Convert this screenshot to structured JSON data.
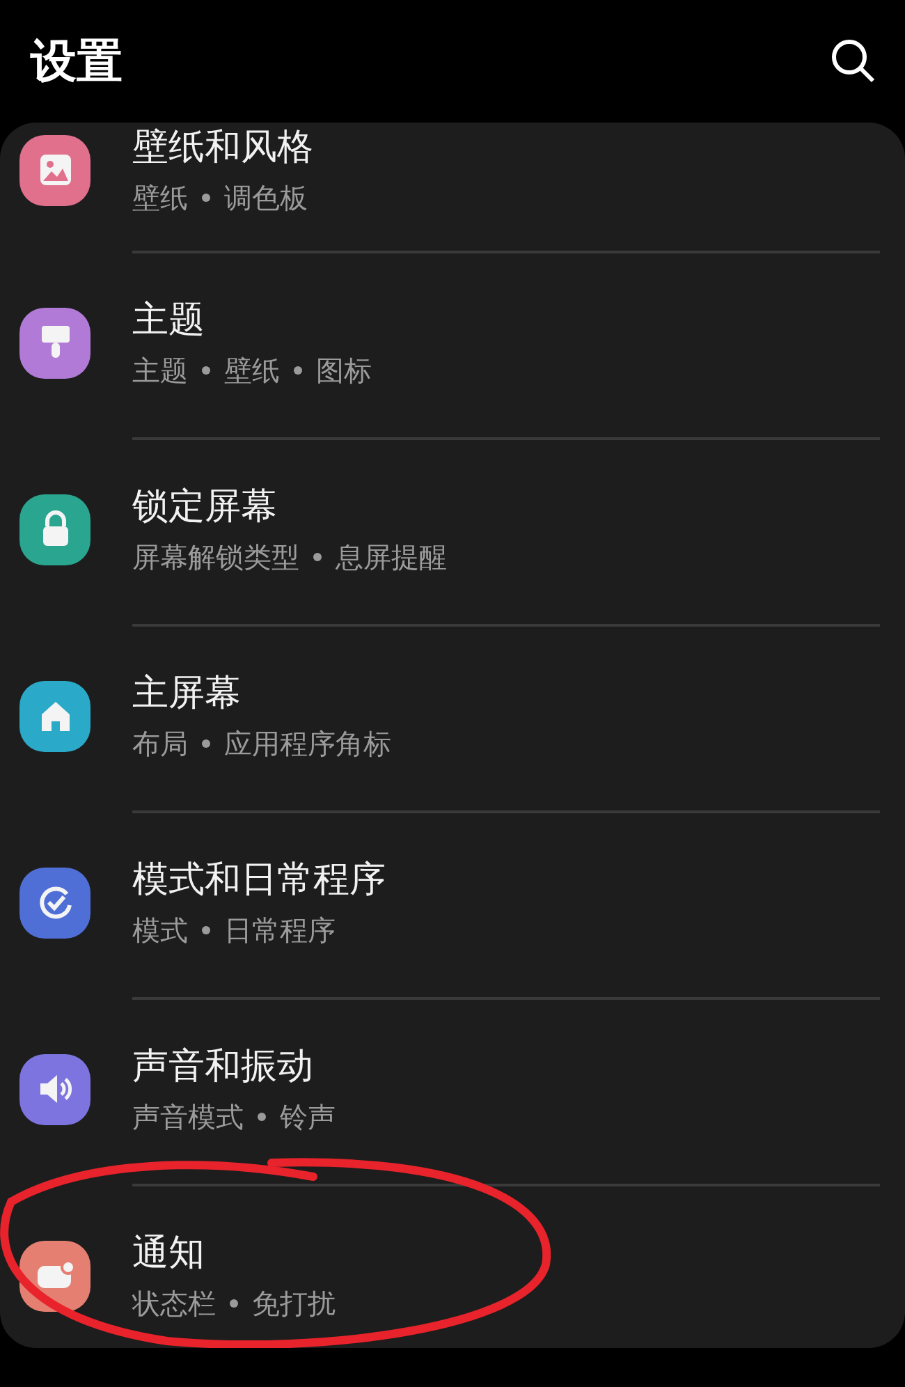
{
  "header": {
    "title": "设置"
  },
  "items": [
    {
      "kind": "image",
      "color": "#e0708c",
      "title": "壁纸和风格",
      "subtitles": [
        "壁纸",
        "调色板"
      ],
      "circled": false
    },
    {
      "kind": "brush",
      "color": "#b07ad6",
      "title": "主题",
      "subtitles": [
        "主题",
        "壁纸",
        "图标"
      ],
      "circled": false
    },
    {
      "kind": "lock",
      "color": "#2aa58f",
      "title": "锁定屏幕",
      "subtitles": [
        "屏幕解锁类型",
        "息屏提醒"
      ],
      "circled": false
    },
    {
      "kind": "home",
      "color": "#2aa9c9",
      "title": "主屏幕",
      "subtitles": [
        "布局",
        "应用程序角标"
      ],
      "circled": false
    },
    {
      "kind": "check",
      "color": "#4f6fd6",
      "title": "模式和日常程序",
      "subtitles": [
        "模式",
        "日常程序"
      ],
      "circled": false
    },
    {
      "kind": "sound",
      "color": "#7d74e0",
      "title": "声音和振动",
      "subtitles": [
        "声音模式",
        "铃声"
      ],
      "circled": false
    },
    {
      "kind": "notification",
      "color": "#e57f72",
      "title": "通知",
      "subtitles": [
        "状态栏",
        "免打扰"
      ],
      "circled": true
    }
  ]
}
